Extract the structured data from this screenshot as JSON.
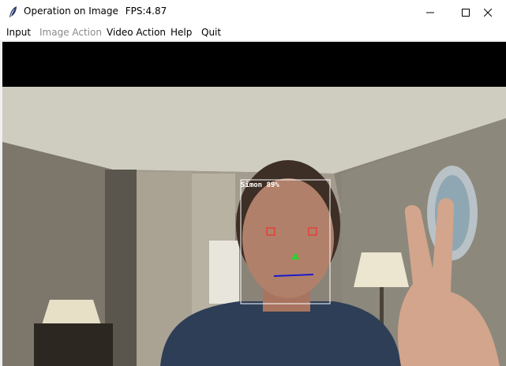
{
  "window": {
    "title": "Operation on Image",
    "fps_text": "FPS:4.87"
  },
  "menu": {
    "items": [
      {
        "label": "Input",
        "enabled": true
      },
      {
        "label": "Image Action",
        "enabled": false
      },
      {
        "label": "Video Action",
        "enabled": true
      },
      {
        "label": "Help",
        "enabled": true
      },
      {
        "label": "Quit",
        "enabled": true
      }
    ]
  },
  "detection": {
    "name": "Simon",
    "confidence_text": "89%",
    "label": "Simon 89%",
    "box_color": "#ffffff",
    "eye_marker_color": "#ff2020",
    "nose_marker_color": "#30d030",
    "mouth_line_color": "#1a1acc"
  },
  "icons": {
    "app": "feather-icon",
    "minimize": "minimize-icon",
    "maximize": "maximize-icon",
    "close": "close-icon"
  }
}
